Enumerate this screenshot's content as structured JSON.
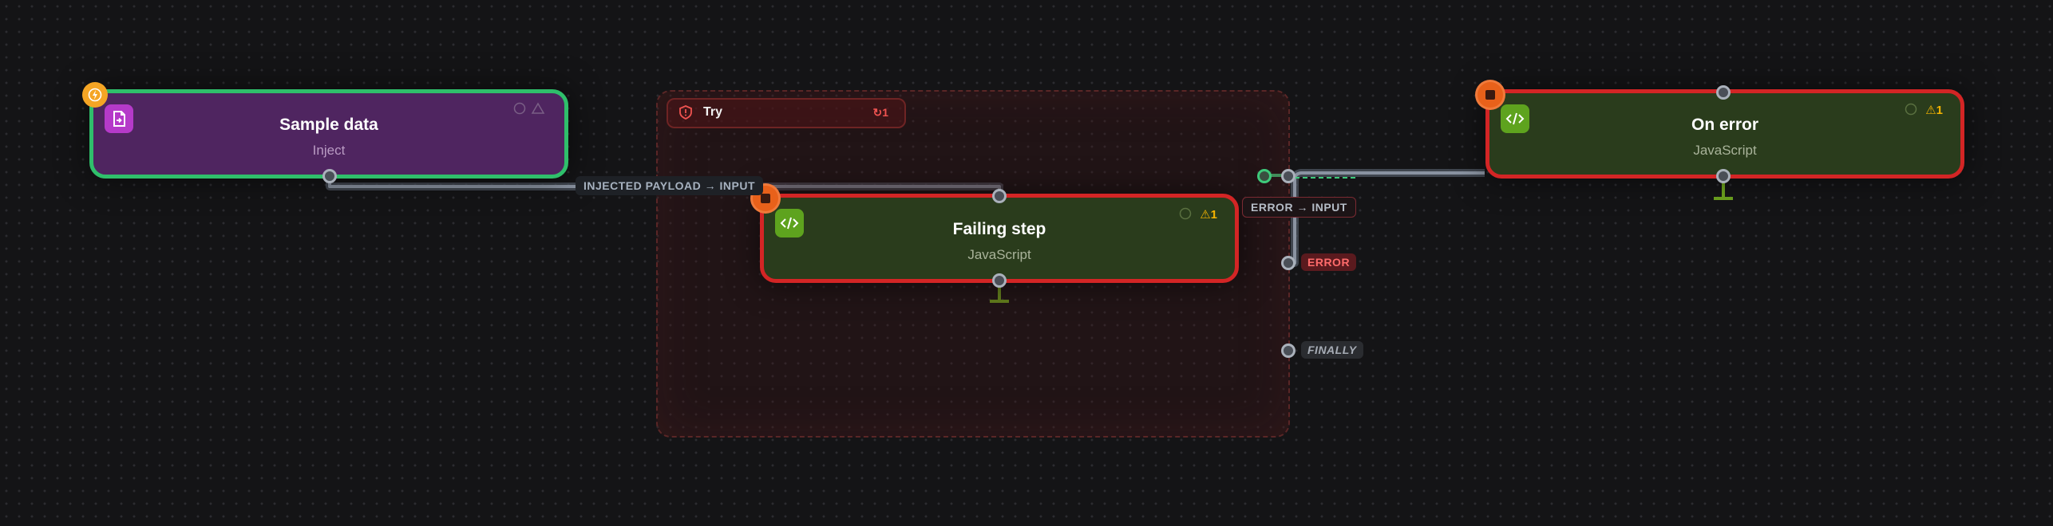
{
  "group": {
    "title": "Try",
    "retry_count": "1"
  },
  "nodes": {
    "sample": {
      "title": "Sample data",
      "subtitle": "Inject"
    },
    "failing": {
      "title": "Failing step",
      "subtitle": "JavaScript",
      "warnings": "1"
    },
    "onerror": {
      "title": "On error",
      "subtitle": "JavaScript",
      "warnings": "1"
    }
  },
  "edges": {
    "payload_label": "INJECTED PAYLOAD → INPUT",
    "error_input_label": "ERROR → INPUT"
  },
  "ports": {
    "error": "ERROR",
    "finally": "FINALLY"
  },
  "colors": {
    "sample_border": "#2fbf6b",
    "sample_fill": "#4f2560",
    "js_fill": "#2a3c1c",
    "error_border": "#d32525",
    "trigger_badge": "#f5a524",
    "stop_badge": "#e8611a",
    "error_text": "#ff6b6b"
  }
}
